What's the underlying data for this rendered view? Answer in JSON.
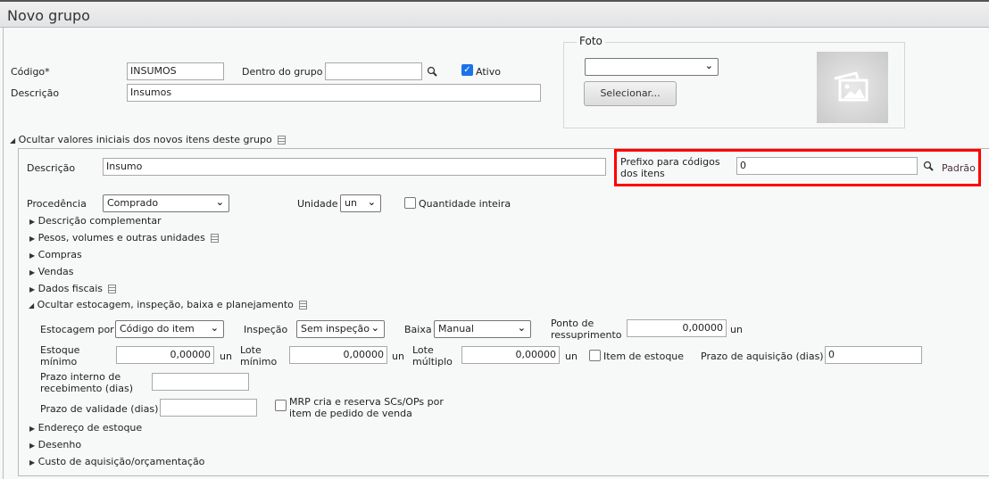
{
  "window": {
    "title": "Novo grupo"
  },
  "group": {
    "codigo_label": "Código*",
    "codigo_value": "INSUMOS",
    "dentro_label": "Dentro do grupo",
    "dentro_value": "",
    "ativo_label": "Ativo",
    "ativo_checked": true,
    "descricao_label": "Descrição",
    "descricao_value": "Insumos"
  },
  "foto": {
    "legend": "Foto",
    "select_value": "",
    "button_label": "Selecionar..."
  },
  "initial_values": {
    "toggle_label": "Ocultar valores iniciais dos novos itens deste grupo",
    "descricao_label": "Descrição",
    "descricao_value": "Insumo",
    "prefixo_label_1": "Prefixo para códigos",
    "prefixo_label_2": "dos itens",
    "prefixo_value": "0",
    "padrao_link": "Padrão",
    "procedencia_label": "Procedência",
    "procedencia_value": "Comprado",
    "unidade_label": "Unidade",
    "unidade_value": "un",
    "qtd_inteira_label": "Quantidade inteira",
    "qtd_inteira_checked": false,
    "sections": [
      "Descrição complementar",
      "Pesos, volumes e outras unidades",
      "Compras",
      "Vendas",
      "Dados fiscais"
    ],
    "estocagem": {
      "toggle_label": "Ocultar estocagem, inspeção, baixa e planejamento",
      "estocagem_label": "Estocagem por",
      "estocagem_value": "Código do item",
      "inspecao_label": "Inspeção",
      "inspecao_value": "Sem inspeção",
      "baixa_label": "Baixa",
      "baixa_value": "Manual",
      "ponto_label_1": "Ponto de",
      "ponto_label_2": "ressuprimento",
      "ponto_value": "0,00000",
      "unit": "un",
      "estoque_min_label_1": "Estoque",
      "estoque_min_label_2": "mínimo",
      "estoque_min_value": "0,00000",
      "lote_min_label_1": "Lote",
      "lote_min_label_2": "mínimo",
      "lote_min_value": "0,00000",
      "lote_mult_label_1": "Lote",
      "lote_mult_label_2": "múltiplo",
      "lote_mult_value": "0,00000",
      "item_estoque_label": "Item de estoque",
      "item_estoque_checked": false,
      "prazo_aq_label": "Prazo de aquisição (dias)",
      "prazo_aq_value": "0",
      "prazo_int_label_1": "Prazo interno de",
      "prazo_int_label_2": "recebimento (dias)",
      "prazo_int_value": "",
      "prazo_val_label": "Prazo de validade (dias)",
      "prazo_val_value": "",
      "mrp_label_1": "MRP cria e reserva SCs/OPs por",
      "mrp_label_2": "item de pedido de venda",
      "mrp_checked": false
    },
    "sections_after": [
      "Endereço de estoque",
      "Desenho",
      "Custo de aquisição/orçamentação"
    ]
  },
  "colors": {
    "highlight": "#ff0000",
    "checkbox": "#1a73e8"
  }
}
